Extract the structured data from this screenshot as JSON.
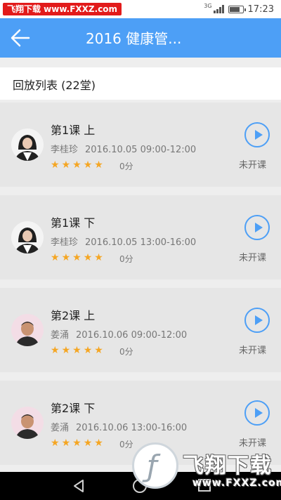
{
  "status_bar": {
    "watermark_text": "飞翔下载 www.FXXZ.com",
    "network": "3G",
    "time": "17:23"
  },
  "app_bar": {
    "title": "2016 健康管...",
    "back_icon": "arrow-left-icon"
  },
  "list": {
    "header": "回放列表 (22堂)",
    "items": [
      {
        "title": "第1课 上",
        "teacher": "李桂珍",
        "datetime": "2016.10.05 09:00-12:00",
        "stars": 5,
        "score": "0分",
        "status": "未开课",
        "avatar": "female-teacher"
      },
      {
        "title": "第1课 下",
        "teacher": "李桂珍",
        "datetime": "2016.10.05 13:00-16:00",
        "stars": 5,
        "score": "0分",
        "status": "未开课",
        "avatar": "female-teacher"
      },
      {
        "title": "第2课 上",
        "teacher": "姜涌",
        "datetime": "2016.10.06 09:00-12:00",
        "stars": 5,
        "score": "0分",
        "status": "未开课",
        "avatar": "male-teacher"
      },
      {
        "title": "第2课 下",
        "teacher": "姜涌",
        "datetime": "2016.10.06 13:00-16:00",
        "stars": 5,
        "score": "0分",
        "status": "未开课",
        "avatar": "male-teacher"
      }
    ]
  },
  "watermark_logo": {
    "chinese": "飞翔下载",
    "english": "www.FXXZ.com"
  },
  "colors": {
    "accent": "#4d9ff6",
    "star": "#f5a623",
    "card_bg": "#e6e6e6"
  }
}
